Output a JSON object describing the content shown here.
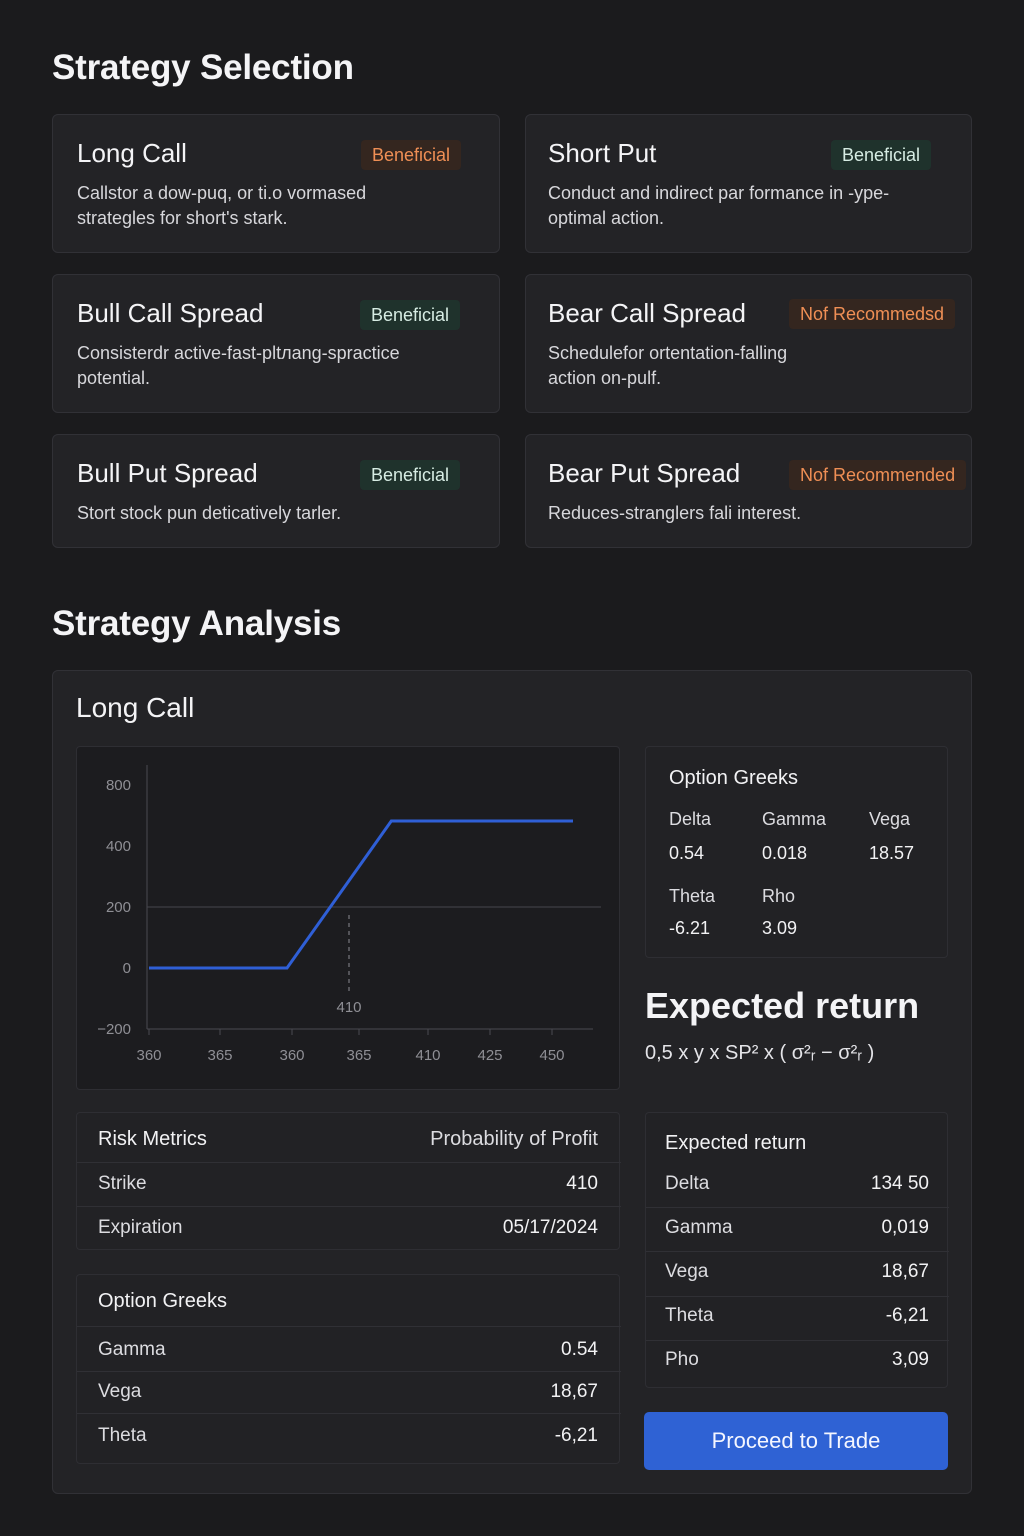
{
  "selection": {
    "title": "Strategy Selection",
    "cards": [
      {
        "title": "Long Call",
        "badge": "Beneficial",
        "badge_color": "#ef8f55",
        "desc1": "Callstor a dow-puq, or ti.o vormased",
        "desc2": "strategles for short's stark."
      },
      {
        "title": "Short Put",
        "badge": "Beneficial",
        "badge_color": "#d6ece3",
        "desc1": "Conduct and indirect par formance in -ype-",
        "desc2": "optimal action."
      },
      {
        "title": "Bull Call Spread",
        "badge": "Beneficial",
        "badge_color": "#d6ece3",
        "desc1": "Consisterdr active-fast-pltлang-spractice",
        "desc2": "potential."
      },
      {
        "title": "Bear Call Spread",
        "badge": "Nof Recommedsd",
        "badge_color": "#ef8f55",
        "desc1": "Schedulefor ortentation-falling",
        "desc2": "action on-pulf."
      },
      {
        "title": "Bull Put Spread",
        "badge": "Beneficial",
        "badge_color": "#d6ece3",
        "desc1": "Stort stock pun deticatively tarler.",
        "desc2": ""
      },
      {
        "title": "Bear Put Spread",
        "badge": "Nof Recommended",
        "badge_color": "#ef8f55",
        "desc1": "Reduces-stranglers fali interest.",
        "desc2": ""
      }
    ]
  },
  "analysis": {
    "title": "Strategy Analysis",
    "strategy_name": "Long Call",
    "greeks_card": {
      "title": "Option Greeks",
      "delta_label": "Delta",
      "delta": "0.54",
      "gamma_label": "Gamma",
      "gamma": "0.018",
      "vega_label": "Vega",
      "vega": "18.57",
      "theta_label": "Theta",
      "theta": "-6.21",
      "rho_label": "Rho",
      "rho": "3.09"
    },
    "expected_return": {
      "title": "Expected return",
      "formula": "0,5 x y x SP² x ( σ²ᵣ − σ²ᵣ )"
    },
    "risk_metrics": {
      "title": "Risk Metrics",
      "header_right": "Probability of Profit",
      "rows": [
        {
          "label": "Strike",
          "value": "410"
        },
        {
          "label": "Expiration",
          "value": "05/17/2024"
        }
      ]
    },
    "option_greeks_table": {
      "title": "Option Greeks",
      "rows": [
        {
          "label": "Gamma",
          "value": "0.54"
        },
        {
          "label": "Vega",
          "value": "18,67"
        },
        {
          "label": "Theta",
          "value": "-6,21"
        }
      ]
    },
    "expected_return_table": {
      "title": "Expected return",
      "rows": [
        {
          "label": "Delta",
          "value": "134 50"
        },
        {
          "label": "Gamma",
          "value": "0,019"
        },
        {
          "label": "Vega",
          "value": "18,67"
        },
        {
          "label": "Theta",
          "value": "-6,21"
        },
        {
          "label": "Pho",
          "value": "3,09"
        }
      ]
    },
    "proceed_button": "Proceed to Trade"
  },
  "colors": {
    "background": "#1b1b1d",
    "card": "#232326",
    "accent_blue": "#2f62d4",
    "line_blue": "#2f5fd6",
    "badge_orange": "#ef8f55",
    "badge_green_bg": "#1f322c"
  },
  "chart_data": {
    "type": "line",
    "title": "",
    "xlabel": "",
    "ylabel": "",
    "x_tick_labels": [
      "360",
      "365",
      "360",
      "365",
      "410",
      "425",
      "450"
    ],
    "y_tick_labels": [
      "800",
      "400",
      "200",
      "0",
      "−200"
    ],
    "annotation": "410",
    "series": [
      {
        "x_index": [
          0,
          2.05,
          3.6,
          6.3
        ],
        "y": [
          0,
          0,
          480,
          480
        ]
      }
    ],
    "grid": "horizontal at 200",
    "legend": "none"
  }
}
